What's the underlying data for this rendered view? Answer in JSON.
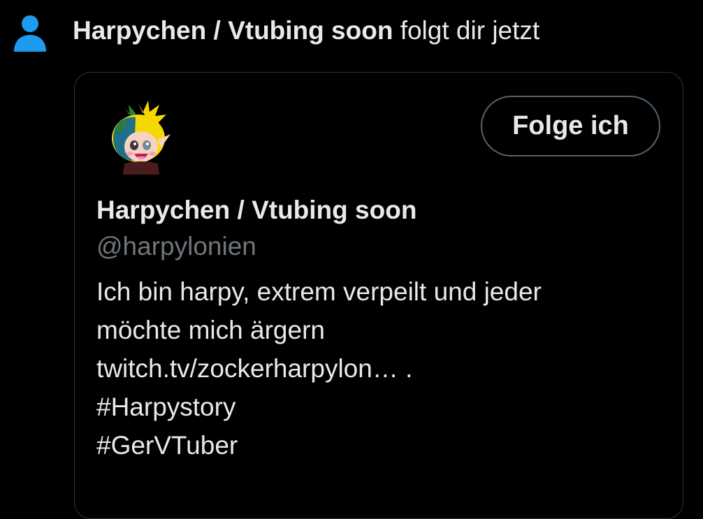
{
  "notification": {
    "icon": "person-icon",
    "actor_name": "Harpychen / Vtubing soon",
    "action_text": " folgt dir jetzt"
  },
  "profile_card": {
    "avatar": "chibi-avatar-image",
    "follow_button_label": "Folge ich",
    "display_name": "Harpychen / Vtubing soon",
    "handle": "@harpylonien",
    "bio_line_1": "Ich bin harpy, extrem verpeilt und jeder",
    "bio_line_2": "möchte mich ärgern",
    "bio_link": "twitch.tv/zockerharpylon… .",
    "hashtag_1": "#Harpystory",
    "hashtag_2": "#GerVTuber"
  },
  "colors": {
    "background": "#000000",
    "text_primary": "#e7e9ea",
    "text_secondary": "#71767b",
    "accent_blue": "#1d9bf0",
    "card_border": "#2f3336",
    "button_border": "#536471"
  }
}
